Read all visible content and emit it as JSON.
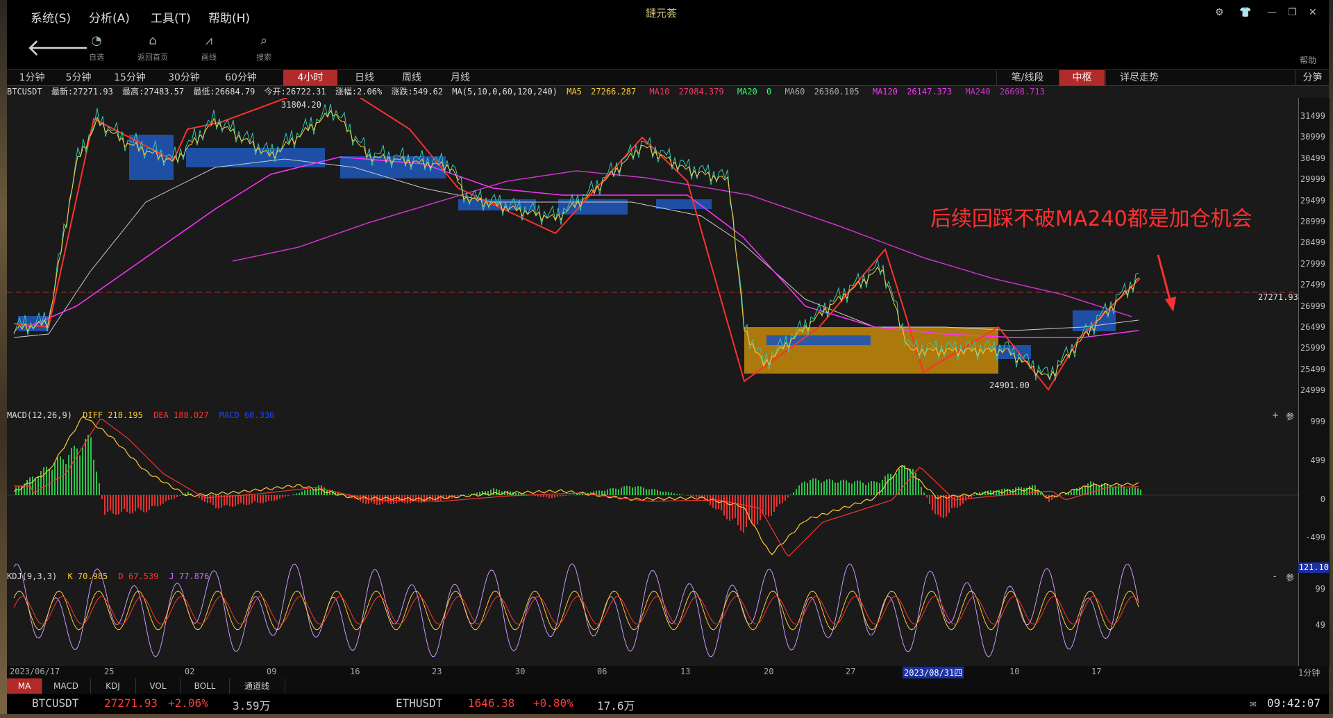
{
  "menu": {
    "items": [
      "系统(S)",
      "分析(A)",
      "工具(T)",
      "帮助(H)"
    ],
    "app_title": "鏈元荟"
  },
  "toolbar": {
    "buttons": [
      {
        "label": "自选",
        "icon": "chart-icon"
      },
      {
        "label": "返回首页",
        "icon": "home-icon"
      },
      {
        "label": "画线",
        "icon": "draw-line-icon"
      },
      {
        "label": "搜索",
        "icon": "search-icon"
      }
    ],
    "help": "帮助"
  },
  "periods": {
    "tabs": [
      "1分钟",
      "5分钟",
      "15分钟",
      "30分钟",
      "60分钟",
      "4小时",
      "日线",
      "周线",
      "月线"
    ],
    "active": "4小时",
    "right_tabs": [
      "笔/线段",
      "中枢",
      "详尽走势"
    ],
    "right_active": "中枢",
    "split": "分笋"
  },
  "quote": {
    "symbol": "BTCUSDT",
    "latest": "最新:27271.93",
    "high": "最高:27483.57",
    "low": "最低:26684.79",
    "open": "今开:26722.31",
    "change_pct": "涨幅:2.06%",
    "change": "涨跌:549.62",
    "ma_def": "MA(5,10,0,60,120,240)",
    "ma": [
      {
        "name": "MA5",
        "value": "27266.287",
        "color": "#ffcc33"
      },
      {
        "name": "MA10",
        "value": "27084.379",
        "color": "#ff3366"
      },
      {
        "name": "MA20",
        "value": "0",
        "color": "#33ff66"
      },
      {
        "name": "MA60",
        "value": "26360.105",
        "color": "#aaaaaa"
      },
      {
        "name": "MA120",
        "value": "26147.373",
        "color": "#ff33ff"
      },
      {
        "name": "MA240",
        "value": "26698.713",
        "color": "#cc33cc"
      }
    ]
  },
  "price_axis": [
    "31499",
    "30999",
    "30499",
    "29999",
    "29499",
    "28999",
    "28499",
    "27999",
    "27499",
    "26999",
    "26499",
    "25999",
    "25499",
    "24999"
  ],
  "price_marks": {
    "high": "31804.20",
    "low": "24901.00",
    "last": "27271.93"
  },
  "annotation": "后续回踩不破MA240都是加仓机会",
  "macd": {
    "title": "MACD(12,26,9)",
    "diff": "DIFF 218.195",
    "dea": "DEA 188.027",
    "macd": "MACD 60.336",
    "axis": [
      "999",
      "499",
      "0",
      "-499"
    ],
    "btn_plus": "+",
    "btn_param": "参"
  },
  "kdj": {
    "title": "KDJ(9,3,3)",
    "k": "K 70.985",
    "d": "D 67.539",
    "j": "J 77.876",
    "axis": [
      "99",
      "49"
    ],
    "top_value": "121.10",
    "btn_minus": "-",
    "btn_param": "参"
  },
  "dates": [
    "2023/06/17",
    "25",
    "02",
    "09",
    "16",
    "23",
    "30",
    "06",
    "13",
    "20",
    "27",
    "2023/08/31四",
    "10",
    "17"
  ],
  "date_period": "1分钟",
  "indicators": {
    "tabs": [
      "MA",
      "MACD",
      "KDJ",
      "VOL",
      "BOLL",
      "通道线"
    ],
    "active": "MA"
  },
  "status": {
    "btc_symbol": "BTCUSDT",
    "btc_price": "27271.93",
    "btc_change": "+2.06%",
    "btc_vol": "3.59万",
    "eth_symbol": "ETHUSDT",
    "eth_price": "1646.38",
    "eth_change": "+0.80%",
    "eth_vol": "17.6万",
    "time": "09:42:07"
  },
  "chart_data": {
    "type": "line",
    "title": "",
    "ylim": [
      24700,
      31900
    ],
    "bi_zigzag": [
      31200,
      29500,
      31100,
      31804.2,
      30100,
      28600,
      30200,
      25200,
      28000,
      25400,
      24901,
      27350
    ],
    "ma240": [
      28000,
      28900,
      29800,
      29700,
      29400,
      29100,
      28200,
      27400,
      26900,
      26700
    ],
    "zhongshu_boxes": [
      {
        "low": 25350,
        "high": 26500,
        "color": "#c88a0a"
      },
      {
        "low": 29900,
        "high": 30950,
        "color": "#1f55b5"
      },
      {
        "low": 28900,
        "high": 29450,
        "color": "#1f55b5"
      }
    ]
  }
}
